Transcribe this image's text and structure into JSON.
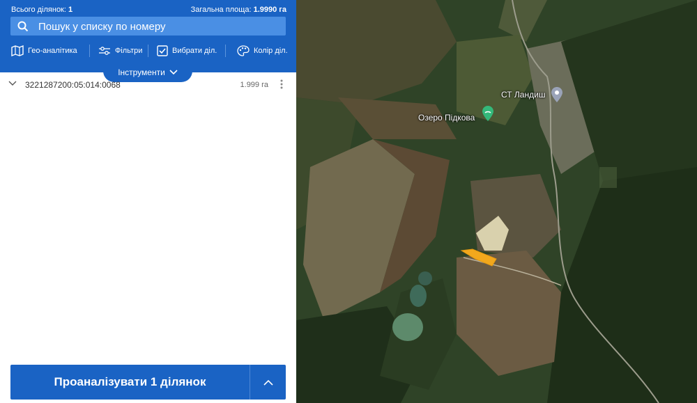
{
  "header": {
    "count_label": "Всього ділянок:",
    "count_value": "1",
    "area_label": "Загальна площа:",
    "area_value": "1.9990 га"
  },
  "search": {
    "placeholder": "Пошук у списку по номеру"
  },
  "toolbar": {
    "geo": "Гео-аналітика",
    "filters": "Фільтри",
    "select": "Вибрати діл.",
    "color": "Колір діл."
  },
  "tools_toggle": "Інструменти",
  "parcels": [
    {
      "number": "3221287200:05:014:0068",
      "area": "1.999 га"
    }
  ],
  "analyze_button": "Проаналізувати 1 ділянок",
  "map": {
    "labels": {
      "settlement": "СТ Ландиш",
      "lake": "Озеро Підкова"
    },
    "colors": {
      "parcel_highlight": "#f2a81d",
      "brand": "#1a63c4"
    }
  }
}
